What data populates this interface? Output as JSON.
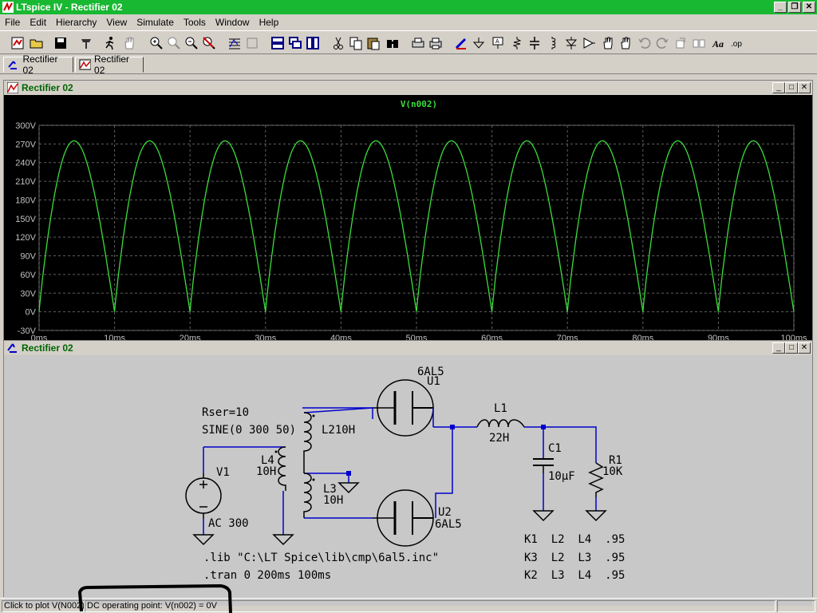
{
  "window": {
    "title": "LTspice IV - Rectifier 02"
  },
  "menu": [
    "File",
    "Edit",
    "Hierarchy",
    "View",
    "Simulate",
    "Tools",
    "Window",
    "Help"
  ],
  "toolbar": {
    "tools": [
      "new-schematic",
      "open",
      "save",
      "control-panel",
      "run",
      "halt",
      "zoom-in",
      "pan",
      "zoom-out",
      "zoom-cancel",
      "autoscale",
      "fit",
      "tile-horizontal",
      "cascade",
      "tile-vertical",
      "cut",
      "copy",
      "paste",
      "find",
      "print-setup",
      "print",
      "draw-wire",
      "ground",
      "label-net",
      "resistor",
      "capacitor",
      "inductor",
      "diode",
      "component",
      "move",
      "drag",
      "undo",
      "redo",
      "rotate",
      "mirror",
      "text",
      "spice-directive"
    ]
  },
  "tabs": [
    {
      "label": "Rectifier 02",
      "kind": "schematic"
    },
    {
      "label": "Rectifier 02",
      "kind": "waveform"
    }
  ],
  "plot_window": {
    "title": "Rectifier 02"
  },
  "schematic_window": {
    "title": "Rectifier 02"
  },
  "colors": {
    "titlebar": "#19b832",
    "trace": "#3cdc3c",
    "plot_bg": "#000000",
    "wire": "#0000cc",
    "schematic_bg": "#c8c8c8"
  },
  "chart_data": {
    "type": "line",
    "title": "V(n002)",
    "xlabel": "",
    "ylabel": "",
    "x_ticks": [
      "0ms",
      "10ms",
      "20ms",
      "30ms",
      "40ms",
      "50ms",
      "60ms",
      "70ms",
      "80ms",
      "90ms",
      "100ms"
    ],
    "y_ticks": [
      "-30V",
      "0V",
      "30V",
      "60V",
      "90V",
      "120V",
      "150V",
      "180V",
      "210V",
      "240V",
      "270V",
      "300V"
    ],
    "xlim": [
      0,
      100
    ],
    "ylim": [
      -30,
      300
    ],
    "grid": true,
    "series": [
      {
        "name": "V(n002)",
        "shape": "full-wave rectified sine",
        "amplitude": 275,
        "period_ms": 10,
        "color": "#3cdc3c"
      }
    ]
  },
  "schematic": {
    "components": {
      "U1": {
        "ref": "U1",
        "model": "6AL5"
      },
      "U2": {
        "ref": "U2",
        "model": "6AL5"
      },
      "L1": {
        "ref": "L1",
        "value": "22H"
      },
      "C1": {
        "ref": "C1",
        "value": "10µF"
      },
      "R1": {
        "ref": "R1",
        "value": "10K"
      },
      "V1": {
        "ref": "V1",
        "rser": "Rser=10",
        "sine": "SINE(0 300 50)",
        "ac": "AC 300"
      },
      "L2": {
        "ref": "L2",
        "value": "10H"
      },
      "L3": {
        "ref": "L3",
        "value": "10H"
      },
      "L4": {
        "ref": "L4",
        "value": "10H"
      }
    },
    "directives": [
      ".lib \"C:\\LT Spice\\lib\\cmp\\6al5.inc\"",
      ".tran 0 200ms 100ms"
    ],
    "coupling": [
      "K1  L2  L4  .95",
      "K3  L2  L3  .95",
      "K2  L3  L4  .95"
    ]
  },
  "status": {
    "left": "Click to plot V(N002)",
    "right": "DC operating point: V(n002) = 0V"
  }
}
